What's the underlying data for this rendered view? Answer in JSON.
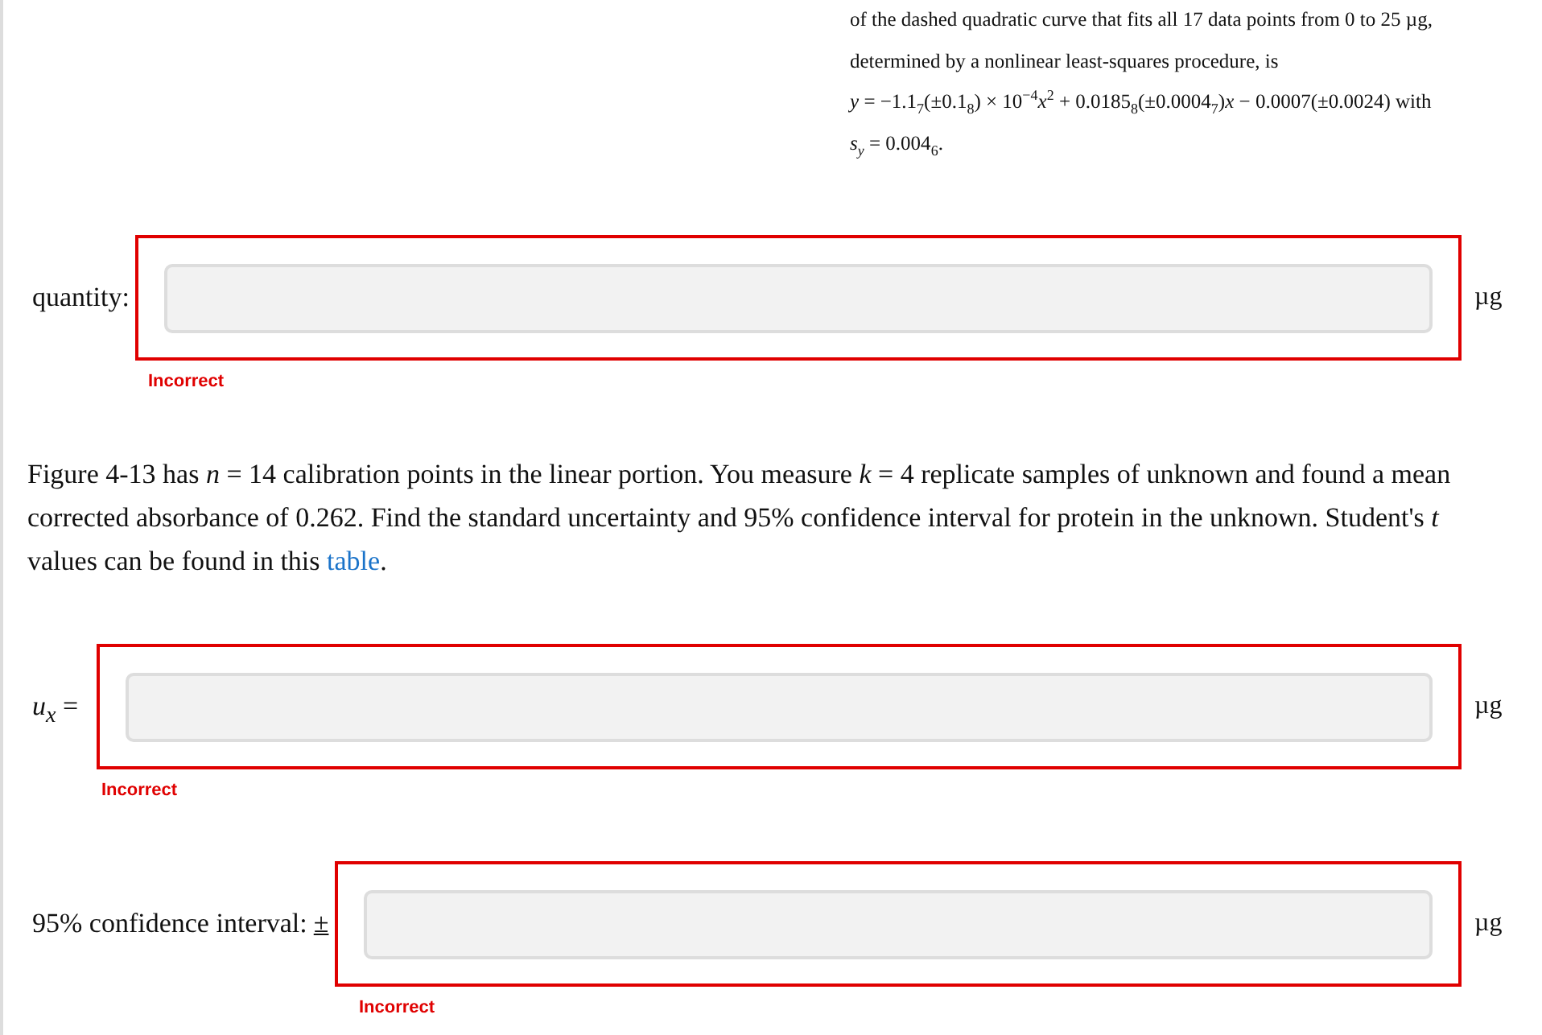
{
  "intro_lines": [
    "of the dashed quadratic curve that fits all 17 data points from 0 to 25 µg,",
    "determined by a nonlinear least-squares procedure, is",
    "*y* = −1.1$_{7}$(±0.1$_{8}$) × 10$^{−4}$*x*$^{2}$ + 0.0185$_{8}$(±0.0004$_{7}$)*x* − 0.0007(±0.0024) with",
    "*s$_{y}$* = 0.004$_{6}$."
  ],
  "answers_top": [
    {
      "label": "quantity:",
      "unit": "µg",
      "incorrect": true,
      "feedback": "Incorrect"
    }
  ],
  "problem": {
    "text": "Figure 4-13 has *n* = 14 calibration points in the linear portion. You measure *k* = 4 replicate samples of unknown and found a mean corrected absorbance of 0.262. Find the standard uncertainty and 95% confidence interval for protein in the unknown. Student's *t* values can be found in this ",
    "link": "table",
    "after": "."
  },
  "answers": [
    {
      "label": "*u$_{x}$* =",
      "unit": "µg",
      "incorrect": true,
      "feedback": "Incorrect"
    },
    {
      "label": "95% confidence interval:",
      "prefix": "±",
      "unit": "µg",
      "incorrect": true,
      "feedback": "Incorrect"
    }
  ]
}
